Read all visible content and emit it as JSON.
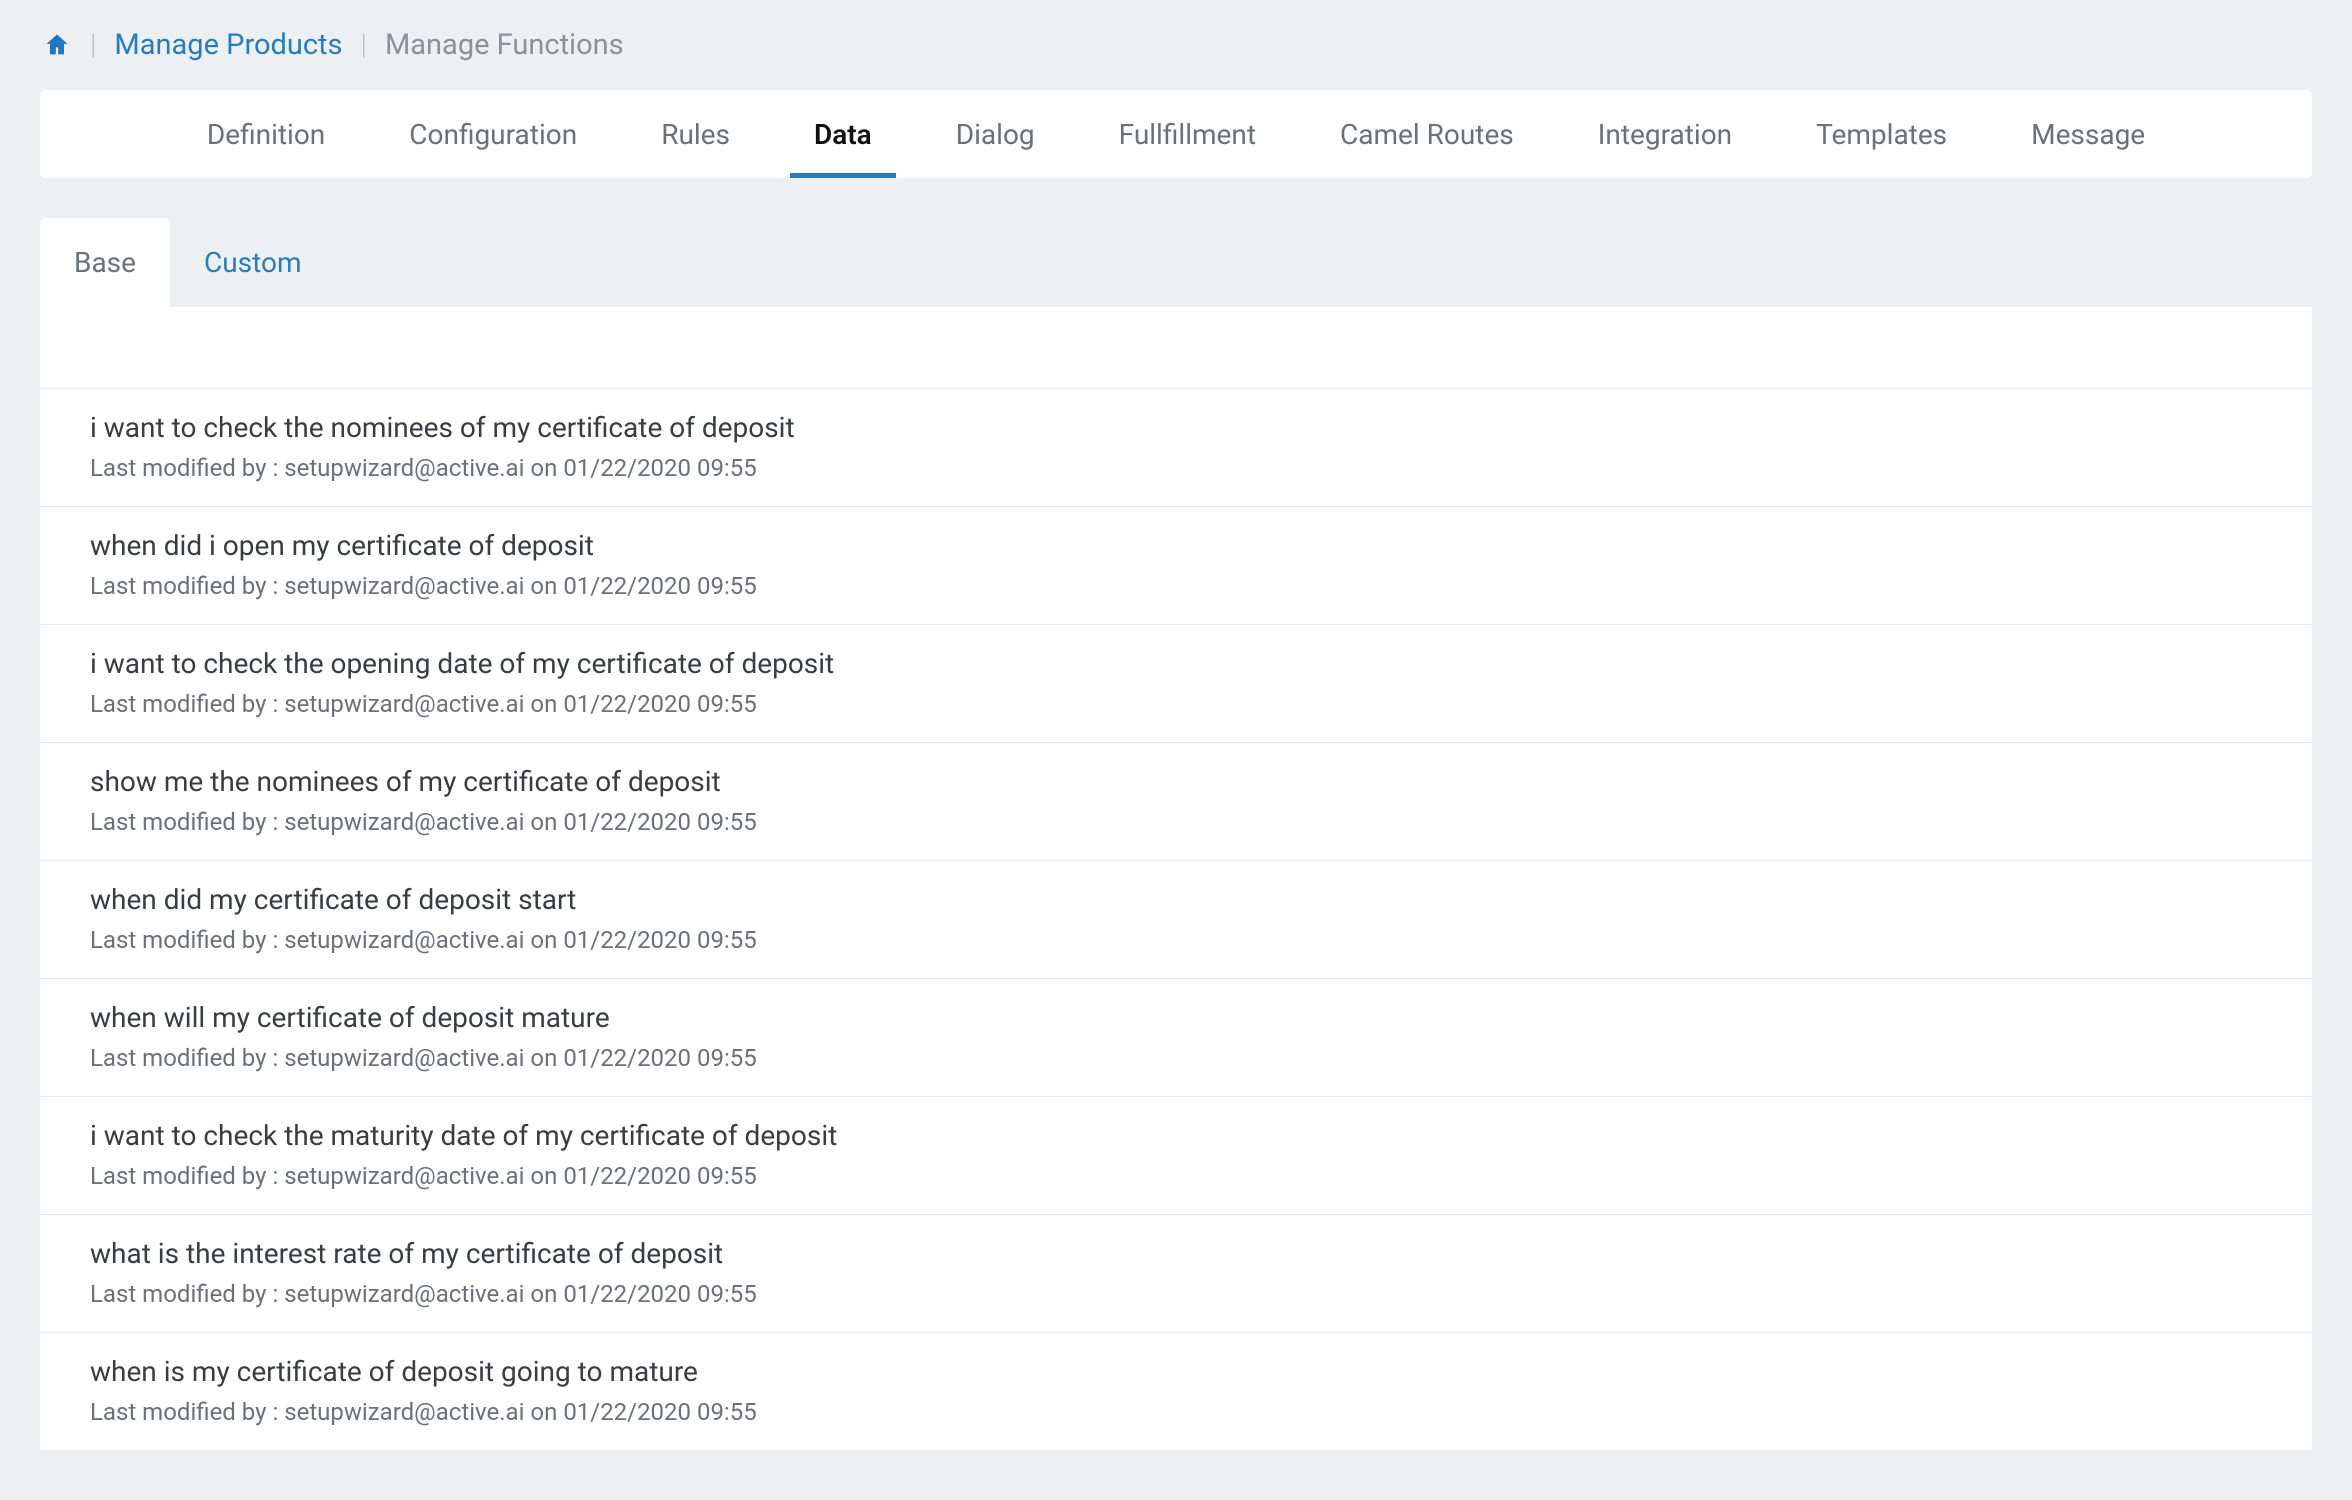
{
  "colors": {
    "accent": "#2a7bbd",
    "bg": "#edf0f2"
  },
  "breadcrumb": {
    "home_label": "Home",
    "items": [
      {
        "label": "Manage Products",
        "link": true
      },
      {
        "label": "Manage Functions",
        "link": false
      }
    ]
  },
  "top_tabs": [
    {
      "label": "Definition",
      "active": false
    },
    {
      "label": "Configuration",
      "active": false
    },
    {
      "label": "Rules",
      "active": false
    },
    {
      "label": "Data",
      "active": true
    },
    {
      "label": "Dialog",
      "active": false
    },
    {
      "label": "Fullfillment",
      "active": false
    },
    {
      "label": "Camel Routes",
      "active": false
    },
    {
      "label": "Integration",
      "active": false
    },
    {
      "label": "Templates",
      "active": false
    },
    {
      "label": "Message",
      "active": false
    }
  ],
  "sub_tabs": [
    {
      "label": "Base",
      "active": true
    },
    {
      "label": "Custom",
      "active": false
    }
  ],
  "meta_label_prefix": "Last modified by : ",
  "meta_on": " on ",
  "rows": [
    {
      "title": "i want to check the nominees of my certificate of deposit",
      "modified_by": "setupwizard@active.ai",
      "modified_on": "01/22/2020 09:55"
    },
    {
      "title": "when did i open my certificate of deposit",
      "modified_by": "setupwizard@active.ai",
      "modified_on": "01/22/2020 09:55"
    },
    {
      "title": "i want to check the opening date of my certificate of deposit",
      "modified_by": "setupwizard@active.ai",
      "modified_on": "01/22/2020 09:55"
    },
    {
      "title": "show me the nominees of my certificate of deposit",
      "modified_by": "setupwizard@active.ai",
      "modified_on": "01/22/2020 09:55"
    },
    {
      "title": "when did my certificate of deposit start",
      "modified_by": "setupwizard@active.ai",
      "modified_on": "01/22/2020 09:55"
    },
    {
      "title": "when will my certificate of deposit mature",
      "modified_by": "setupwizard@active.ai",
      "modified_on": "01/22/2020 09:55"
    },
    {
      "title": "i want to check the maturity date of my certificate of deposit",
      "modified_by": "setupwizard@active.ai",
      "modified_on": "01/22/2020 09:55"
    },
    {
      "title": "what is the interest rate of my certificate of deposit",
      "modified_by": "setupwizard@active.ai",
      "modified_on": "01/22/2020 09:55"
    },
    {
      "title": "when is my certificate of deposit going to mature",
      "modified_by": "setupwizard@active.ai",
      "modified_on": "01/22/2020 09:55"
    }
  ]
}
